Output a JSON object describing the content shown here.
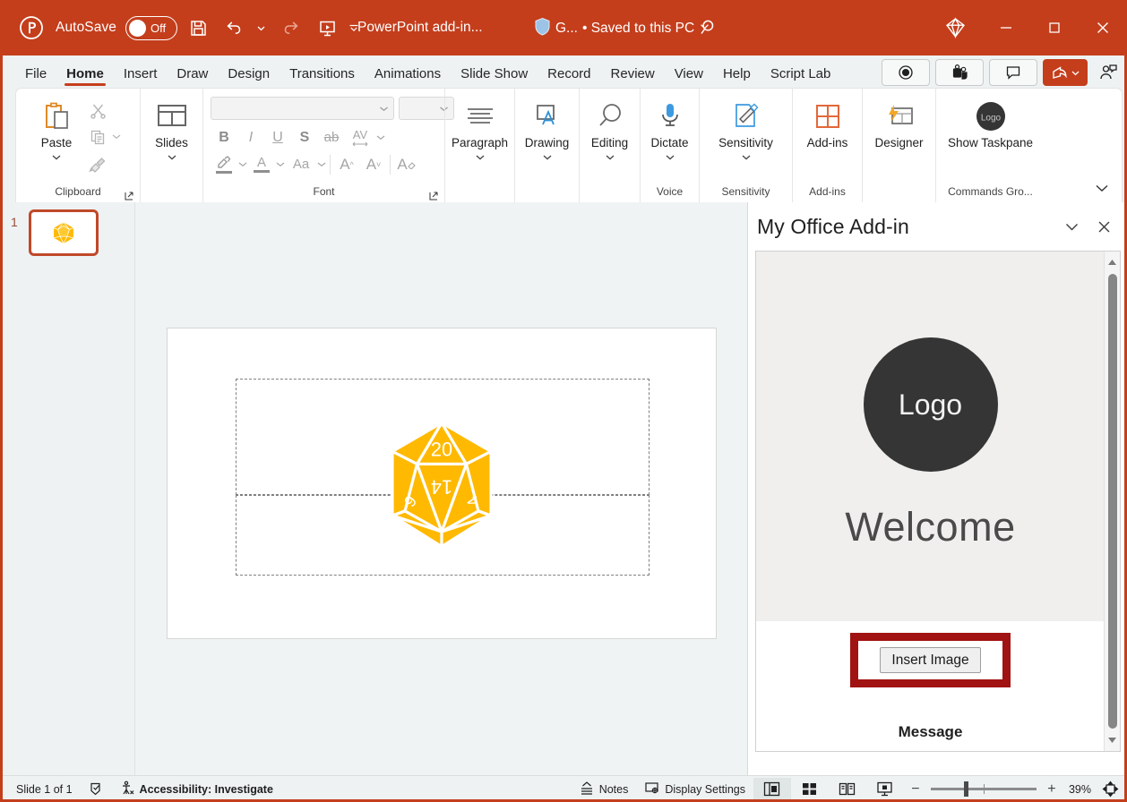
{
  "titlebar": {
    "app_icon": "powerpoint-icon",
    "autosave_label": "AutoSave",
    "autosave_state": "Off",
    "save_icon": "save-icon",
    "undo_icon": "undo-icon",
    "redo_icon": "redo-icon",
    "present_icon": "start-presentation-icon",
    "qat_more_icon": "quick-access-more-icon",
    "document_title": "PowerPoint add-in...",
    "sensitivity_shield_icon": "shield-icon",
    "sensitivity_label": "G...",
    "save_status": "• Saved to this PC",
    "save_status_chevron": "chevron-down-icon",
    "search_icon": "search-icon",
    "copilot_icon": "copilot-diamond-icon",
    "minimize_icon": "minimize-icon",
    "maximize_icon": "maximize-icon",
    "close_icon": "close-icon",
    "accent_color": "#c43e1c"
  },
  "tabs": [
    {
      "label": "File",
      "active": false
    },
    {
      "label": "Home",
      "active": true
    },
    {
      "label": "Insert",
      "active": false
    },
    {
      "label": "Draw",
      "active": false
    },
    {
      "label": "Design",
      "active": false
    },
    {
      "label": "Transitions",
      "active": false
    },
    {
      "label": "Animations",
      "active": false
    },
    {
      "label": "Slide Show",
      "active": false
    },
    {
      "label": "Record",
      "active": false
    },
    {
      "label": "Review",
      "active": false
    },
    {
      "label": "View",
      "active": false
    },
    {
      "label": "Help",
      "active": false
    },
    {
      "label": "Script Lab",
      "active": false
    }
  ],
  "tabbar_right": {
    "record_icon": "record-circle-icon",
    "teams_icon": "present-in-teams-icon",
    "comments_icon": "comments-icon",
    "share_icon": "share-icon",
    "share_chevron": "chevron-down-icon",
    "people_icon": "people-collaborate-icon"
  },
  "ribbon": {
    "collapse_icon": "ribbon-collapse-icon",
    "groups": [
      {
        "name": "clipboard",
        "label": "Clipboard",
        "dialog_launcher_icon": "dialog-launcher-icon",
        "paste_label": "Paste",
        "paste_icon": "paste-icon",
        "paste_chevron": "chevron-down-icon",
        "cut_icon": "cut-scissors-icon",
        "copy_icon": "copy-icon",
        "copy_chevron": "chevron-down-icon",
        "format_painter_icon": "format-painter-icon"
      },
      {
        "name": "slides",
        "label": "",
        "slides_label": "Slides",
        "slides_icon": "slide-layout-icon",
        "slides_chevron": "chevron-down-icon"
      },
      {
        "name": "font",
        "label": "Font",
        "dialog_launcher_icon": "dialog-launcher-icon",
        "font_name_value": "",
        "font_name_chevron": "chevron-down-icon",
        "font_size_value": "",
        "font_size_chevron": "chevron-down-icon",
        "bold_label": "B",
        "italic_label": "I",
        "underline_label": "U",
        "shadow_label": "S",
        "strike_label": "ab",
        "spacing_label": "AV",
        "spacing_chevron": "chevron-down-icon",
        "highlight_icon": "text-highlight-icon",
        "highlight_chevron": "chevron-down-icon",
        "fontcolor_label": "A",
        "fontcolor_chevron": "chevron-down-icon",
        "changecase_label": "Aa",
        "changecase_chevron": "chevron-down-icon",
        "grow_label": "A",
        "shrink_label": "A",
        "clearformat_label": "A"
      },
      {
        "name": "paragraph",
        "label": "",
        "btn_label": "Paragraph",
        "icon": "paragraph-align-icon",
        "chevron": "chevron-down-icon"
      },
      {
        "name": "drawing",
        "label": "",
        "btn_label": "Drawing",
        "icon": "drawing-shapes-icon",
        "chevron": "chevron-down-icon"
      },
      {
        "name": "editing",
        "label": "",
        "btn_label": "Editing",
        "icon": "find-magnifier-icon",
        "chevron": "chevron-down-icon"
      },
      {
        "name": "voice",
        "label": "Voice",
        "btn_label": "Dictate",
        "icon": "microphone-icon",
        "chevron": "chevron-down-icon"
      },
      {
        "name": "sensitivity",
        "label": "Sensitivity",
        "btn_label": "Sensitivity",
        "icon": "sensitivity-label-icon",
        "chevron": "chevron-down-icon"
      },
      {
        "name": "addins",
        "label": "Add-ins",
        "btn_label": "Add-ins",
        "icon": "addins-grid-icon"
      },
      {
        "name": "designer",
        "label": "",
        "btn_label": "Designer",
        "icon": "designer-icon"
      },
      {
        "name": "commands-group",
        "label": "Commands Gro...",
        "btn_label": "Show Taskpane",
        "icon": "logo-circle-icon",
        "icon_text": "Logo"
      }
    ]
  },
  "thumbnails": {
    "slides": [
      {
        "number": "1",
        "selected": true,
        "content_icon": "d20-dice-icon"
      }
    ]
  },
  "slide": {
    "title_placeholder_name": "title-placeholder",
    "subtitle_placeholder_name": "subtitle-placeholder",
    "image_name": "d20-dice-image",
    "dice_numbers": [
      "20",
      "14",
      "6",
      "4"
    ],
    "dice_color": "#ffb900"
  },
  "taskpane": {
    "title": "My Office Add-in",
    "collapse_icon": "chevron-down-icon",
    "close_icon": "close-icon",
    "logo_text": "Logo",
    "welcome_text": "Welcome",
    "insert_button_label": "Insert Image",
    "message_text": "Message",
    "highlight_color": "#a11212",
    "scroll_up_icon": "scroll-up-arrow-icon",
    "scroll_down_icon": "scroll-down-arrow-icon"
  },
  "statusbar": {
    "slide_count": "Slide 1 of 1",
    "language_icon": "spellcheck-icon",
    "accessibility_icon": "accessibility-icon",
    "accessibility_text": "Accessibility: Investigate",
    "notes_icon": "notes-icon",
    "notes_label": "Notes",
    "display_settings_icon": "display-settings-icon",
    "display_settings_label": "Display Settings",
    "view_normal_icon": "view-normal-icon",
    "view_sorter_icon": "view-slide-sorter-icon",
    "view_reading_icon": "view-reading-icon",
    "view_slideshow_icon": "view-slideshow-icon",
    "zoom_out_label": "−",
    "zoom_in_label": "+",
    "zoom_value": "39%",
    "fit_slide_icon": "fit-to-window-icon"
  }
}
